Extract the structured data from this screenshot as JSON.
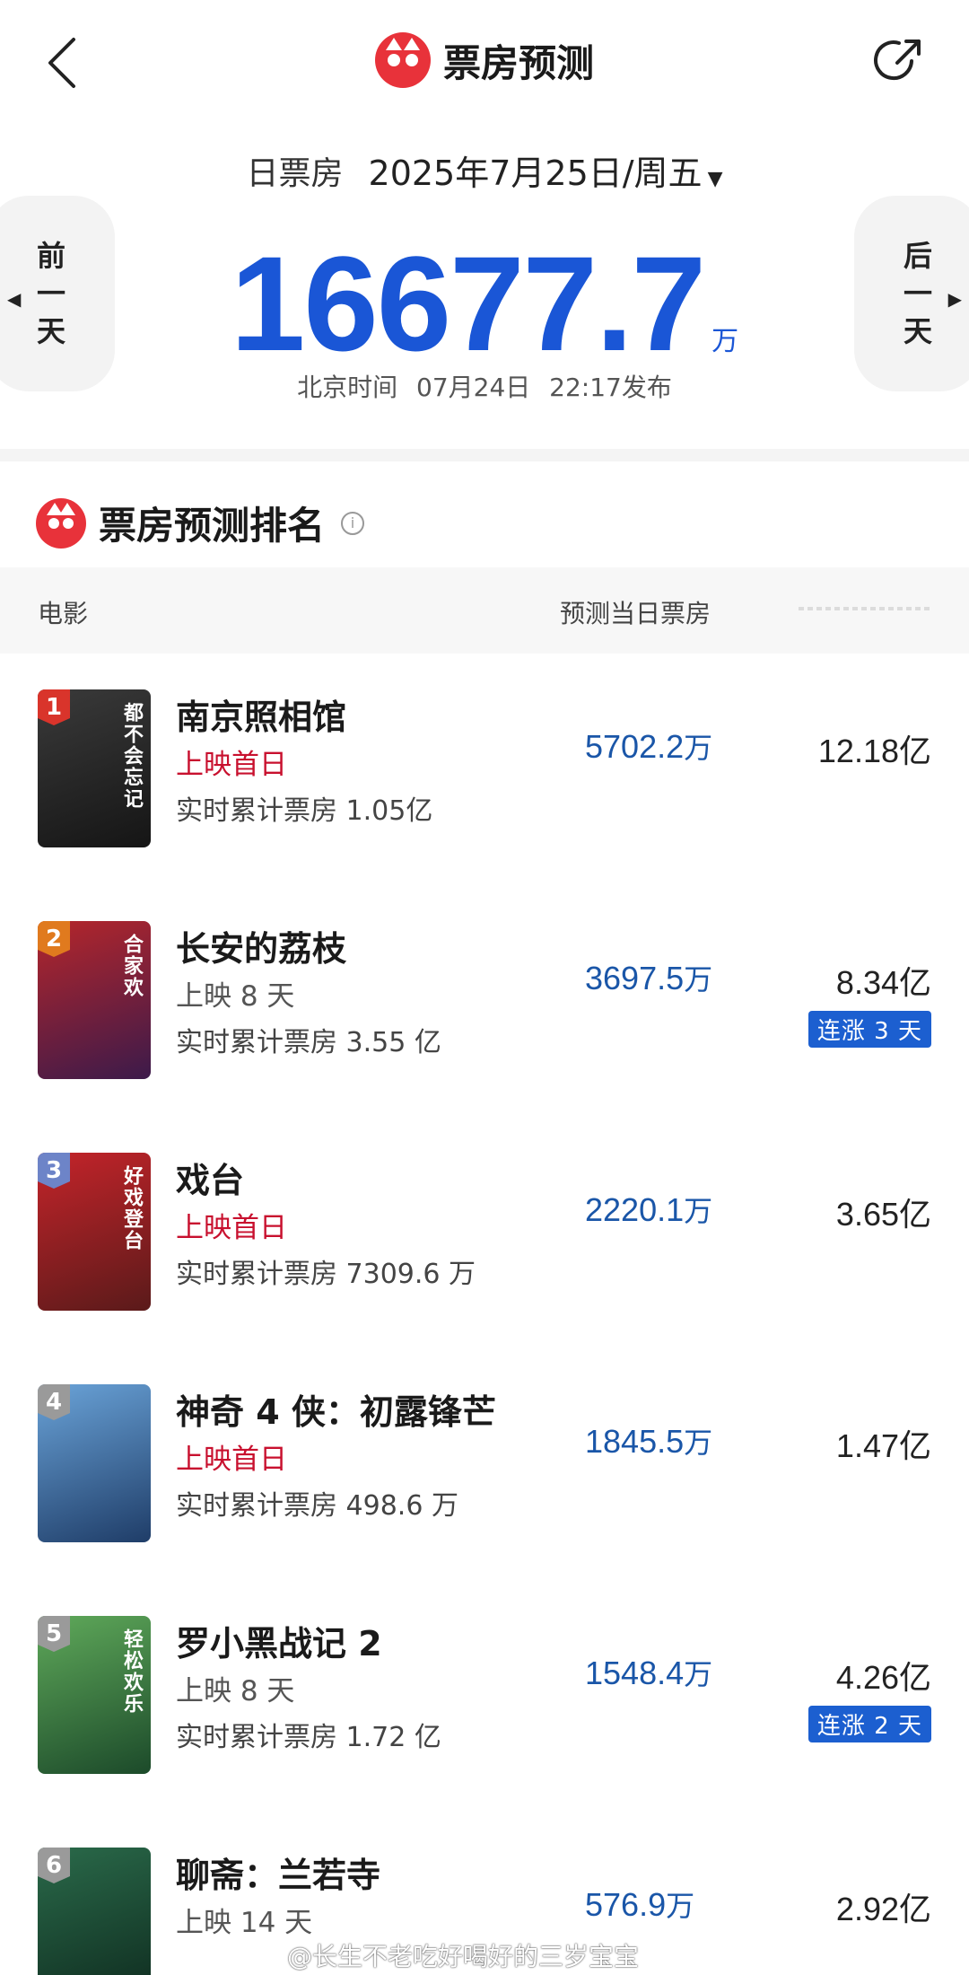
{
  "header": {
    "title": "票房预测"
  },
  "date_bar": {
    "label": "日票房",
    "date": "2025年7月25日/周五",
    "caret": "▼"
  },
  "nav": {
    "prev": [
      "前",
      "一",
      "天"
    ],
    "next": [
      "后",
      "一",
      "天"
    ]
  },
  "summary": {
    "total": "16677.7",
    "unit": "万",
    "publish": "北京时间 07月24日 22:17发布"
  },
  "ranking": {
    "title": "票房预测排名",
    "info_icon": "i",
    "col_movie": "电影",
    "col_pred": "预测当日票房",
    "items": [
      {
        "rank": "1",
        "name": "南京照相馆",
        "status": "上映首日",
        "status_color": "red",
        "cum": "实时累计票房 1.05亿",
        "pred": "5702.2",
        "pred_unit": "万",
        "total": "12.18亿",
        "streak": "",
        "badge_color": "#d9342b",
        "poster_colors": [
          "#3a3a3a",
          "#151515"
        ],
        "poster_text": "都不会忘记"
      },
      {
        "rank": "2",
        "name": "长安的荔枝",
        "status": "上映 8 天",
        "status_color": "gray",
        "cum": "实时累计票房 3.55 亿",
        "pred": "3697.5",
        "pred_unit": "万",
        "total": "8.34亿",
        "streak": "连涨 3 天",
        "badge_color": "#e07a1e",
        "poster_colors": [
          "#b5262b",
          "#3c1a4a"
        ],
        "poster_text": "合家欢"
      },
      {
        "rank": "3",
        "name": "戏台",
        "status": "上映首日",
        "status_color": "red",
        "cum": "实时累计票房 7309.6 万",
        "pred": "2220.1",
        "pred_unit": "万",
        "total": "3.65亿",
        "streak": "",
        "badge_color": "#6d84c8",
        "poster_colors": [
          "#c4242a",
          "#5a1a1a"
        ],
        "poster_text": "好戏登台"
      },
      {
        "rank": "4",
        "name": "神奇 4 侠：初露锋芒",
        "status": "上映首日",
        "status_color": "red",
        "cum": "实时累计票房 498.6 万",
        "pred": "1845.5",
        "pred_unit": "万",
        "total": "1.47亿",
        "streak": "",
        "badge_color": "#9a9a9a",
        "poster_colors": [
          "#6aa3d8",
          "#1f3d68"
        ],
        "poster_text": ""
      },
      {
        "rank": "5",
        "name": "罗小黑战记 2",
        "status": "上映 8 天",
        "status_color": "gray",
        "cum": "实时累计票房 1.72 亿",
        "pred": "1548.4",
        "pred_unit": "万",
        "total": "4.26亿",
        "streak": "连涨 2 天",
        "badge_color": "#9a9a9a",
        "poster_colors": [
          "#5fa95a",
          "#1c4a2a"
        ],
        "poster_text": "轻松欢乐"
      },
      {
        "rank": "6",
        "name": "聊斋：兰若寺",
        "status": "上映 14 天",
        "status_color": "gray",
        "cum": "",
        "pred": "576.9",
        "pred_unit": "万",
        "total": "2.92亿",
        "streak": "",
        "badge_color": "#9a9a9a",
        "poster_colors": [
          "#2a6a4a",
          "#0e2a1e"
        ],
        "poster_text": ""
      }
    ]
  },
  "watermark": "@长生不老吃好喝好的三岁宝宝",
  "colors": {
    "accent_blue": "#1a56d6",
    "brand_red": "#e8323a",
    "status_red": "#c8102e",
    "streak_blue": "#1c5fd0"
  }
}
